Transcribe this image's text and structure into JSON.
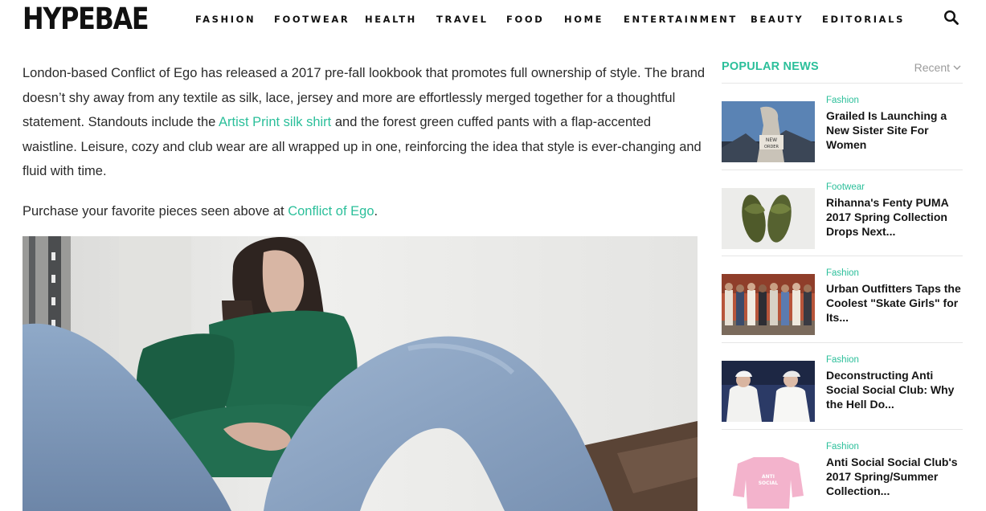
{
  "brand": {
    "logo": "HYPEBAE"
  },
  "nav": {
    "items": [
      {
        "label": "FASHION"
      },
      {
        "label": "FOOTWEAR"
      },
      {
        "label": "HEALTH"
      },
      {
        "label": "TRAVEL"
      },
      {
        "label": "FOOD"
      },
      {
        "label": "HOME"
      },
      {
        "label": "ENTERTAINMENT"
      },
      {
        "label": "BEAUTY"
      },
      {
        "label": "EDITORIALS"
      }
    ],
    "search_icon": "search-icon"
  },
  "article": {
    "p1_before": "London-based Conflict of Ego has released a 2017 pre-fall lookbook that promotes full ownership of style. The brand doesn’t shy away from any textile as silk, lace, jersey and more are effortlessly merged together for a thoughtful statement. Standouts include the ",
    "p1_link": "Artist Print silk shirt",
    "p1_after": " and the forest green cuffed pants with a flap-accented waistline. Leisure, cozy and club wear are all wrapped up in one, reinforcing the idea that style is ever-changing and fluid with time.",
    "p2_before": "Purchase your favorite pieces seen above at ",
    "p2_link": "Conflict of Ego",
    "p2_after": "."
  },
  "sidebar": {
    "title": "POPULAR NEWS",
    "filter": "Recent",
    "items": [
      {
        "category": "Fashion",
        "title": "Grailed Is Launching a New Sister Site For Women"
      },
      {
        "category": "Footwear",
        "title": "Rihanna's Fenty PUMA 2017 Spring Collection Drops Next..."
      },
      {
        "category": "Fashion",
        "title": "Urban Outfitters Taps the Coolest \"Skate Girls\" for Its..."
      },
      {
        "category": "Fashion",
        "title": "Deconstructing Anti Social Social Club: Why the Hell Do..."
      },
      {
        "category": "Fashion",
        "title": "Anti Social Social Club's 2017 Spring/Summer Collection..."
      }
    ]
  },
  "colors": {
    "accent": "#2bbf9a",
    "text": "#2a2a2a",
    "muted": "#9b9b9b",
    "rule": "#e6e6e6"
  }
}
